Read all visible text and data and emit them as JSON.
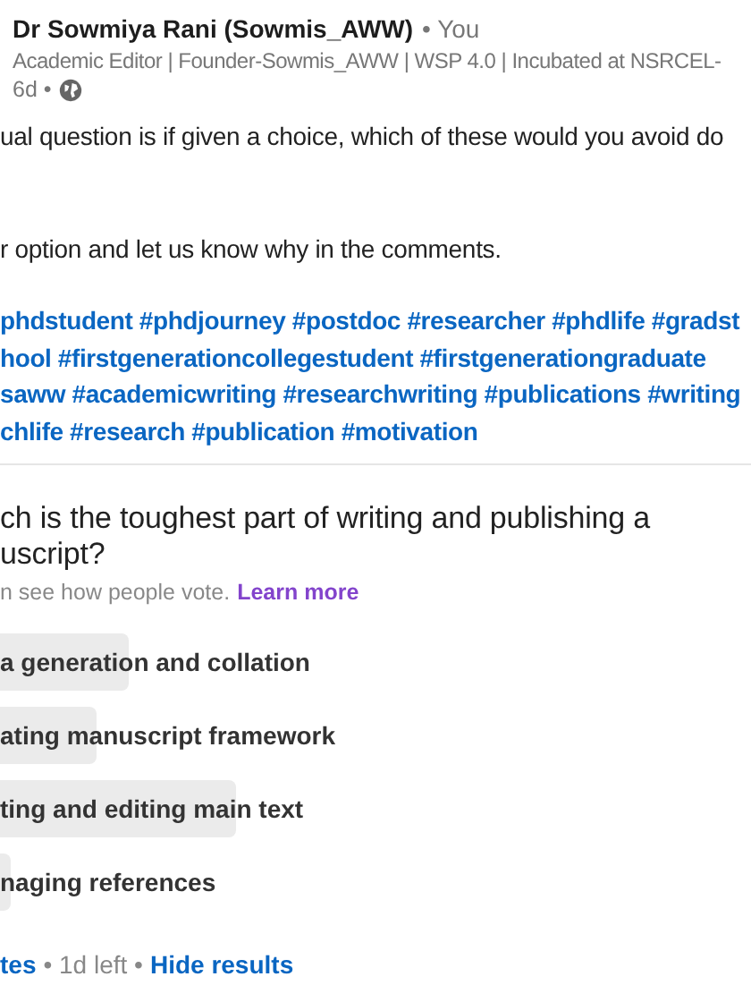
{
  "author": {
    "name": "Dr Sowmiya Rani (Sowmis_AWW)",
    "relation": "• You",
    "headline": "Academic Editor | Founder-Sowmis_AWW | WSP 4.0 | Incubated at NSRCEL-",
    "age": "6d •"
  },
  "body": {
    "lines": [
      "ual question is if given a choice, which of these would you avoid do",
      "r option and let us know why in the comments."
    ],
    "hashtag_lines": [
      "phdstudent #phdjourney #postdoc #researcher #phdlife #gradst",
      "hool #firstgenerationcollegestudent #firstgenerationgraduate",
      "saww #academicwriting #researchwriting #publications #writing",
      "chlife #research #publication #motivation"
    ]
  },
  "poll": {
    "question_lines": [
      "ch is the toughest part of writing and publishing a",
      "uscript?"
    ],
    "note": "n see how people vote.",
    "learn_more": "Learn more",
    "options": [
      {
        "label": "a generation and collation",
        "level": 0.18
      },
      {
        "label": "ating manuscript framework",
        "level": 0.135
      },
      {
        "label": "ting and editing main text",
        "level": 0.33
      },
      {
        "label": "naging references",
        "level": 0.015
      }
    ],
    "footer": {
      "votes": "tes",
      "time_left": "• 1d left •",
      "hide_results": "Hide results"
    }
  }
}
